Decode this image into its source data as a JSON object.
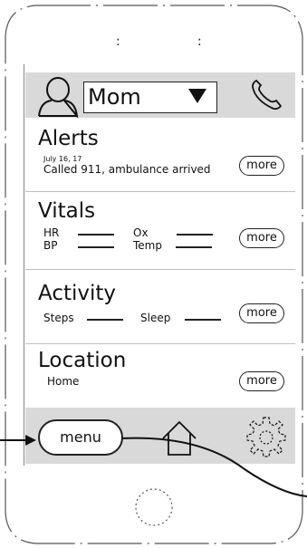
{
  "status_bar": {
    "left_dots": ":",
    "right_dots": ":"
  },
  "header": {
    "contact_name": "Mom",
    "icons": [
      "person-icon",
      "caret-down-icon",
      "phone-icon"
    ]
  },
  "alerts": {
    "title": "Alerts",
    "date": "July 16, 17",
    "message": "Called 911, ambulance arrived",
    "more_label": "more"
  },
  "vitals": {
    "title": "Vitals",
    "hr_label": "HR",
    "ox_label": "Ox",
    "bp_label": "BP",
    "temp_label": "Temp",
    "more_label": "more"
  },
  "activity": {
    "title": "Activity",
    "steps_label": "Steps",
    "sleep_label": "Sleep",
    "more_label": "more"
  },
  "location": {
    "title": "Location",
    "value": "Home",
    "more_label": "more"
  },
  "nav": {
    "menu_label": "menu",
    "icons": [
      "home-icon",
      "gear-icon"
    ]
  }
}
